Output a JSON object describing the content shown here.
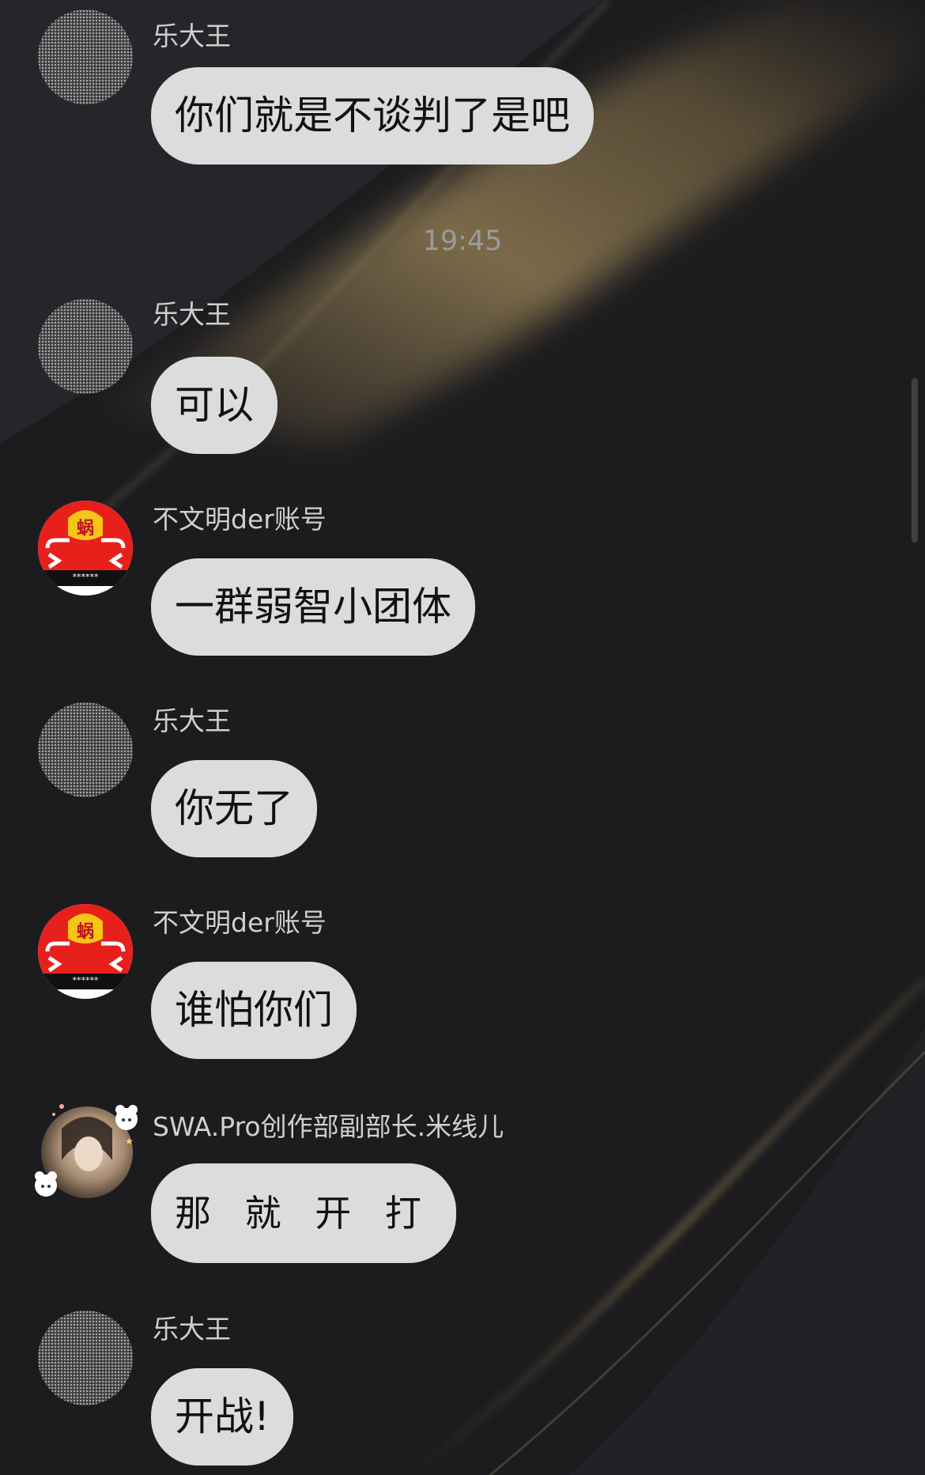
{
  "chat": {
    "timestamp": "19:45",
    "messages": [
      {
        "sender": "乐大王",
        "text": "你们就是不谈判了是吧",
        "avatar": "dotted-avatar"
      },
      {
        "sender": "乐大王",
        "text": "可以",
        "avatar": "dotted-avatar"
      },
      {
        "sender": "不文明der账号",
        "text": "一群弱智小团体",
        "avatar": "red-emoji-avatar",
        "avatar_caption": "******"
      },
      {
        "sender": "乐大王",
        "text": "你无了",
        "avatar": "dotted-avatar"
      },
      {
        "sender": "不文明der账号",
        "text": "谁怕你们",
        "avatar": "red-emoji-avatar",
        "avatar_caption": "******"
      },
      {
        "sender": "SWA.Pro创作部副部长.米线儿",
        "text": "那 就 开 打",
        "avatar": "girl-photo-avatar"
      },
      {
        "sender": "乐大王",
        "text": "开战!",
        "avatar": "dotted-avatar"
      }
    ]
  },
  "colors": {
    "background": "#1c1c1f",
    "bubble": "#dcdcdc",
    "bubble_text": "#111111",
    "sender_text": "#cfcfcf",
    "timestamp_text": "#9b9b9b",
    "gold_streak": "#8a7650",
    "red_avatar": "#e8201c"
  }
}
